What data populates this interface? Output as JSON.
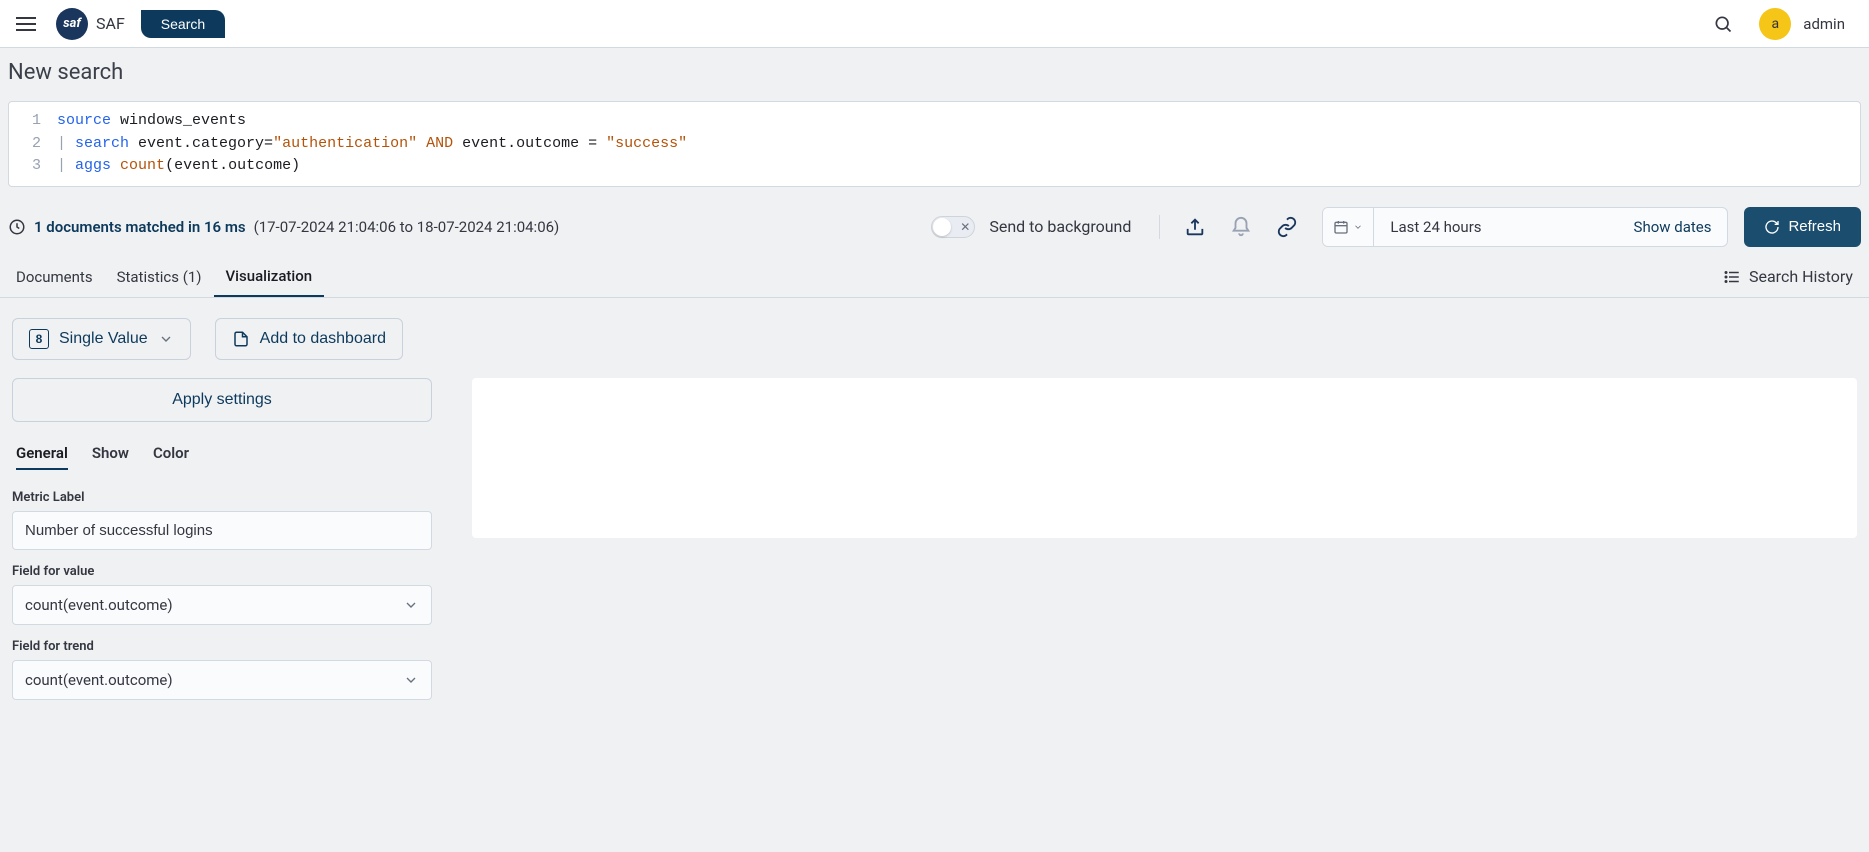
{
  "header": {
    "app_name": "SAF",
    "search_btn": "Search",
    "avatar_initial": "a",
    "username": "admin"
  },
  "page_title": "New search",
  "query": {
    "lines": [
      {
        "num": "1",
        "tokens": [
          {
            "t": "kw",
            "v": "source"
          },
          {
            "t": "txt",
            "v": " windows_events"
          }
        ]
      },
      {
        "num": "2",
        "tokens": [
          {
            "t": "pipe",
            "v": "| "
          },
          {
            "t": "kw",
            "v": "search"
          },
          {
            "t": "txt",
            "v": " event.category="
          },
          {
            "t": "str",
            "v": "\"authentication\""
          },
          {
            "t": "txt",
            "v": " "
          },
          {
            "t": "op",
            "v": "AND"
          },
          {
            "t": "txt",
            "v": " event.outcome = "
          },
          {
            "t": "str",
            "v": "\"success\""
          }
        ]
      },
      {
        "num": "3",
        "tokens": [
          {
            "t": "pipe",
            "v": "| "
          },
          {
            "t": "kw",
            "v": "aggs"
          },
          {
            "t": "txt",
            "v": " "
          },
          {
            "t": "fn",
            "v": "count"
          },
          {
            "t": "txt",
            "v": "(event.outcome)"
          }
        ]
      }
    ]
  },
  "results": {
    "summary": "1 documents matched in 16 ms",
    "range": "(17-07-2024 21:04:06 to 18-07-2024 21:04:06)",
    "send_to_background": "Send to background",
    "date_range": "Last 24 hours",
    "show_dates": "Show dates",
    "refresh": "Refresh"
  },
  "tabs": {
    "documents": "Documents",
    "statistics": "Statistics (1)",
    "visualization": "Visualization",
    "search_history": "Search History"
  },
  "vis_controls": {
    "single_value": "Single Value",
    "single_value_num": "8",
    "add_to_dashboard": "Add to dashboard"
  },
  "settings": {
    "apply": "Apply settings",
    "tab_general": "General",
    "tab_show": "Show",
    "tab_color": "Color",
    "metric_label": "Metric Label",
    "metric_value": "Number of successful logins",
    "field_for_value_label": "Field for value",
    "field_for_value": "count(event.outcome)",
    "field_for_trend_label": "Field for trend",
    "field_for_trend": "count(event.outcome)"
  }
}
